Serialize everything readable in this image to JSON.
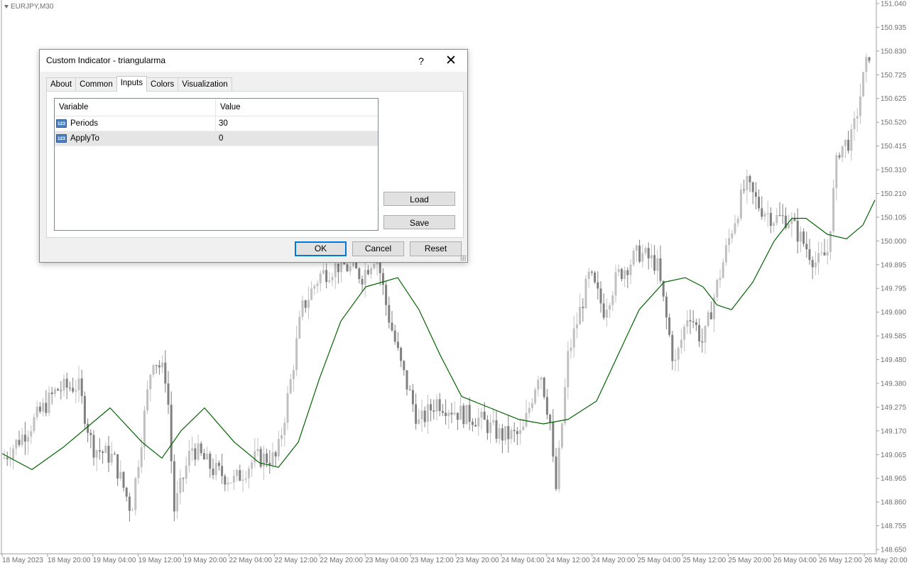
{
  "chart": {
    "symbol": "EURJPY,M30",
    "price_labels": [
      "151.040",
      "150.935",
      "150.830",
      "150.725",
      "150.625",
      "150.520",
      "150.415",
      "150.310",
      "150.210",
      "150.105",
      "150.000",
      "149.895",
      "149.795",
      "149.690",
      "149.585",
      "149.480",
      "149.380",
      "149.275",
      "149.170",
      "149.065",
      "148.965",
      "148.860",
      "148.755",
      "148.650"
    ],
    "time_labels": [
      "18 May 2023",
      "18 May 20:00",
      "19 May 04:00",
      "19 May 12:00",
      "19 May 20:00",
      "22 May 04:00",
      "22 May 12:00",
      "22 May 20:00",
      "23 May 04:00",
      "23 May 12:00",
      "23 May 20:00",
      "24 May 04:00",
      "24 May 12:00",
      "24 May 20:00",
      "25 May 04:00",
      "25 May 12:00",
      "25 May 20:00",
      "26 May 04:00",
      "26 May 12:00",
      "26 May 20:00"
    ],
    "colors": {
      "candle": "#808080",
      "candle_light": "#c0c0c0",
      "ma_line": "#006400",
      "axis": "#a0a0a0",
      "axis_text": "#707070"
    }
  },
  "dialog": {
    "title": "Custom Indicator - triangularma",
    "help_glyph": "?",
    "close_glyph": "✕",
    "tabs": [
      "About",
      "Common",
      "Inputs",
      "Colors",
      "Visualization"
    ],
    "active_tab": "Inputs",
    "table": {
      "headers": {
        "variable": "Variable",
        "value": "Value"
      },
      "rows": [
        {
          "icon": "integer-param-icon",
          "icon_text": "123",
          "variable": "Periods",
          "value": "30"
        },
        {
          "icon": "integer-param-icon",
          "icon_text": "123",
          "variable": "ApplyTo",
          "value": "0"
        }
      ]
    },
    "buttons": {
      "load": "Load",
      "save": "Save",
      "ok": "OK",
      "cancel": "Cancel",
      "reset": "Reset"
    }
  }
}
